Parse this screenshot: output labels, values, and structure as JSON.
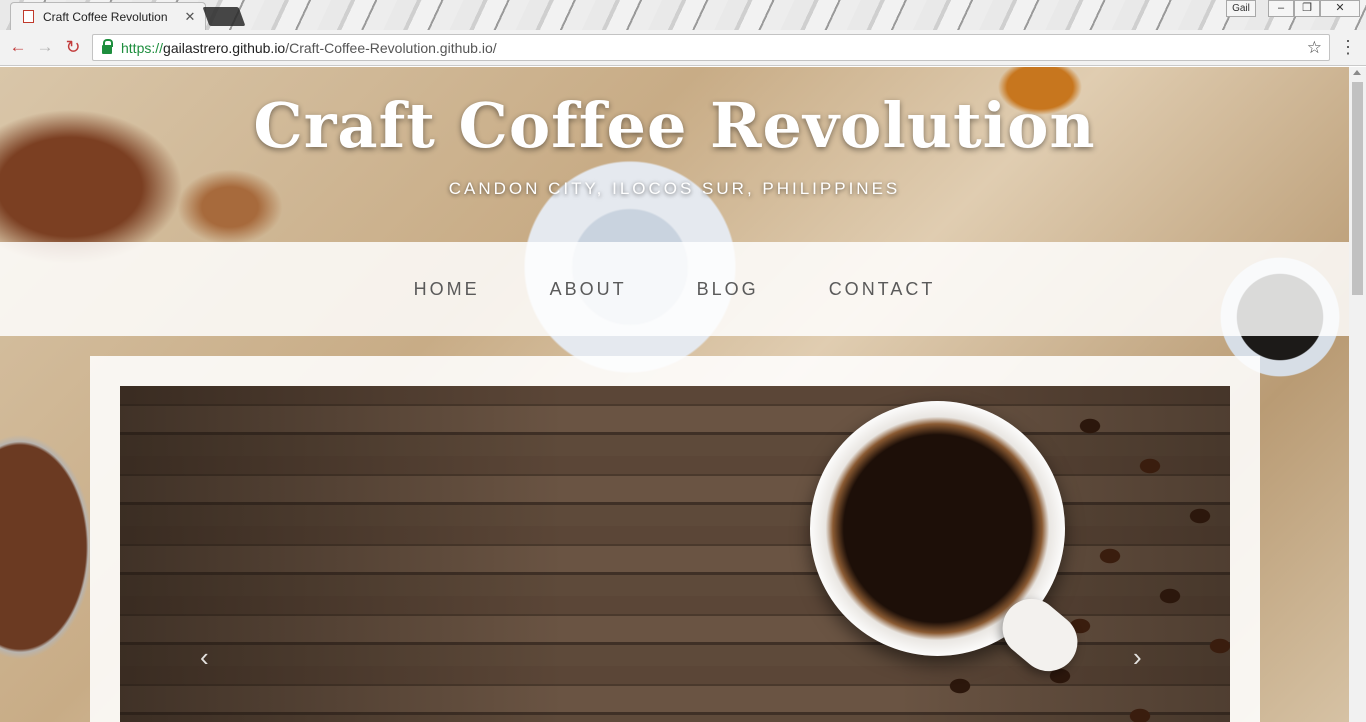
{
  "browser": {
    "tab_title": "Craft Coffee Revolution",
    "tab_close": "✕",
    "profile_name": "Gail",
    "url_scheme": "https://",
    "url_host": "gailastrero.github.io",
    "url_path": "/Craft-Coffee-Revolution.github.io/",
    "icons": [
      "document-icon",
      "back-icon",
      "forward-icon",
      "reload-icon",
      "lock-icon",
      "star-icon",
      "menu-icon"
    ]
  },
  "site": {
    "title": "Craft Coffee Revolution",
    "subtitle": "CANDON CITY, ILOCOS SUR, PHILIPPINES",
    "nav": [
      {
        "label": "HOME"
      },
      {
        "label": "ABOUT"
      },
      {
        "label": "BLOG"
      },
      {
        "label": "CONTACT"
      }
    ]
  },
  "carousel": {
    "prev_glyph": "‹",
    "next_glyph": "›"
  },
  "colors": {
    "secure_green": "#1e8e3e",
    "browser_accent_red": "#c23b3b",
    "nav_text": "#5a5a5a"
  }
}
